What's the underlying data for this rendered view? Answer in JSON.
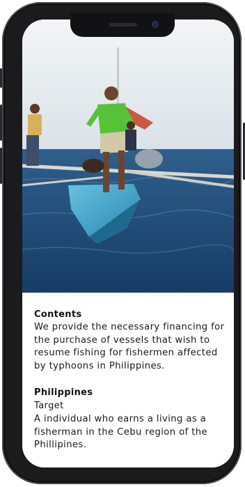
{
  "content": {
    "contents_heading": "Contents",
    "contents_body": "We provide the necessary financing for the purchase of vessels that wish to resume fishing for fishermen affected by typhoons in Philippines.",
    "region_heading": "Philippines",
    "target_label": "Target",
    "target_body": "A individual who earns a living as a fisherman in the Cebu region of the Phillipines."
  },
  "photo": {
    "subject": "fisherman standing on outrigger boat at sea",
    "colors": {
      "sky": "#e7ecef",
      "sea": "#1f4d7a",
      "hull": "#3aa5c8",
      "shirt": "#5bc43a"
    }
  },
  "icons": {
    "camera": "front-camera-icon",
    "speaker": "earpiece-icon"
  }
}
